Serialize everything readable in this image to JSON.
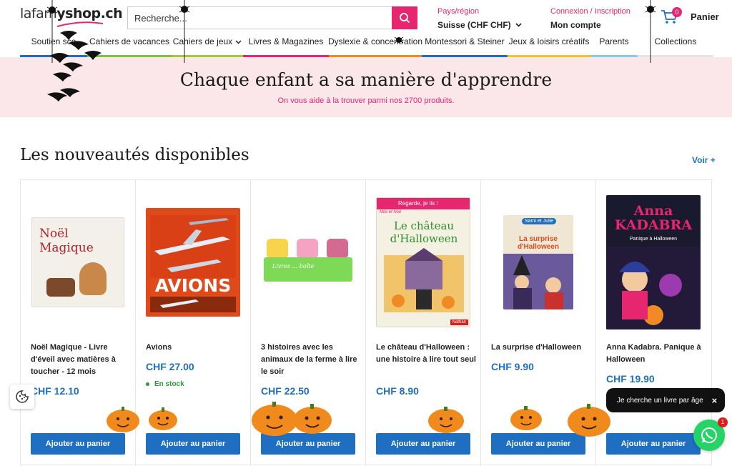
{
  "logo": {
    "part1": "lafam",
    "part2": "yshop.ch"
  },
  "search": {
    "placeholder": "Recherche..."
  },
  "country": {
    "label": "Pays/région",
    "value": "Suisse (CHF CHF)"
  },
  "account": {
    "label": "Connexion / Inscription",
    "value": "Mon compte"
  },
  "cart": {
    "count": "0",
    "label": "Panier"
  },
  "nav": [
    {
      "label": "Soutien sco",
      "color": "#1e6fc1"
    },
    {
      "label": "Cahiers de vacances",
      "color": "#7dc242"
    },
    {
      "label": "Cahiers de jeux",
      "color": "#a3c93a"
    },
    {
      "label": "Livres & Magazines",
      "color": "#e6266e"
    },
    {
      "label": "Dyslexie & concentration",
      "color": "#f08a24"
    },
    {
      "label": "Montessori & Steiner",
      "color": "#1e6fc1"
    },
    {
      "label": "Jeux & loisirs créatifs",
      "color": "#f2c230"
    },
    {
      "label": "Parents",
      "color": "#8fc9e8"
    },
    {
      "label": "Collections",
      "color": "#e5e5e5"
    }
  ],
  "hero": {
    "title": "Chaque enfant a sa manière d'apprendre",
    "subtitle": "On vous aide à la trouver parmi nos 2700 produits."
  },
  "section": {
    "title": "Les nouveautés disponibles",
    "voir": "Voir +"
  },
  "products": [
    {
      "title": "Noël Magique - Livre d'éveil avec matières à toucher - 12 mois",
      "price": "CHF 12.10",
      "stock": "",
      "button": "Ajouter au panier",
      "cover": {
        "bg": "#f3efe9",
        "title": "Noël\nMagique",
        "color": "#b3202c"
      }
    },
    {
      "title": "Avions",
      "price": "CHF 27.00",
      "stock": "En stock",
      "button": "Ajouter au panier",
      "cover": {
        "bg": "#e04a1b",
        "title": "AVIONS",
        "color": "#ffffff"
      }
    },
    {
      "title": "3 histoires avec les animaux de la ferme à lire le soir",
      "price": "CHF 22.50",
      "stock": "",
      "button": "Ajouter au panier",
      "cover": {
        "bg": "#7ed957",
        "title": "Livres ... boîte",
        "color": "#ffffff"
      }
    },
    {
      "title": "Le château d'Halloween : une histoire à lire tout seul",
      "price": "CHF 8.90",
      "stock": "",
      "button": "Ajouter au panier",
      "cover": {
        "bg": "#f4f1e2",
        "title": "Le château\nd'Halloween",
        "color": "#2c8f2c",
        "top": "Regarde, je lis !",
        "brand": "Mila et Noé",
        "footer": "Nathan"
      }
    },
    {
      "title": "La surprise d'Halloween",
      "price": "CHF 9.90",
      "stock": "",
      "button": "Ajouter au panier",
      "cover": {
        "bg": "#f0e6d4",
        "title": "La surprise\nd'Halloween",
        "color": "#e04a1b",
        "brand": "Sami et Julie"
      }
    },
    {
      "title": "Anna Kadabra. Panique à Halloween",
      "price": "CHF 19.90",
      "stock": "",
      "button": "Ajouter au panier",
      "cover": {
        "bg": "#1a1a2e",
        "title": "Anna\nKADABRA",
        "color": "#e6266e",
        "sub": "Panique à Halloween"
      }
    }
  ],
  "chat": {
    "text": "Je cherche un livre par âge",
    "close": "×"
  },
  "whatsapp": {
    "badge": "1"
  }
}
